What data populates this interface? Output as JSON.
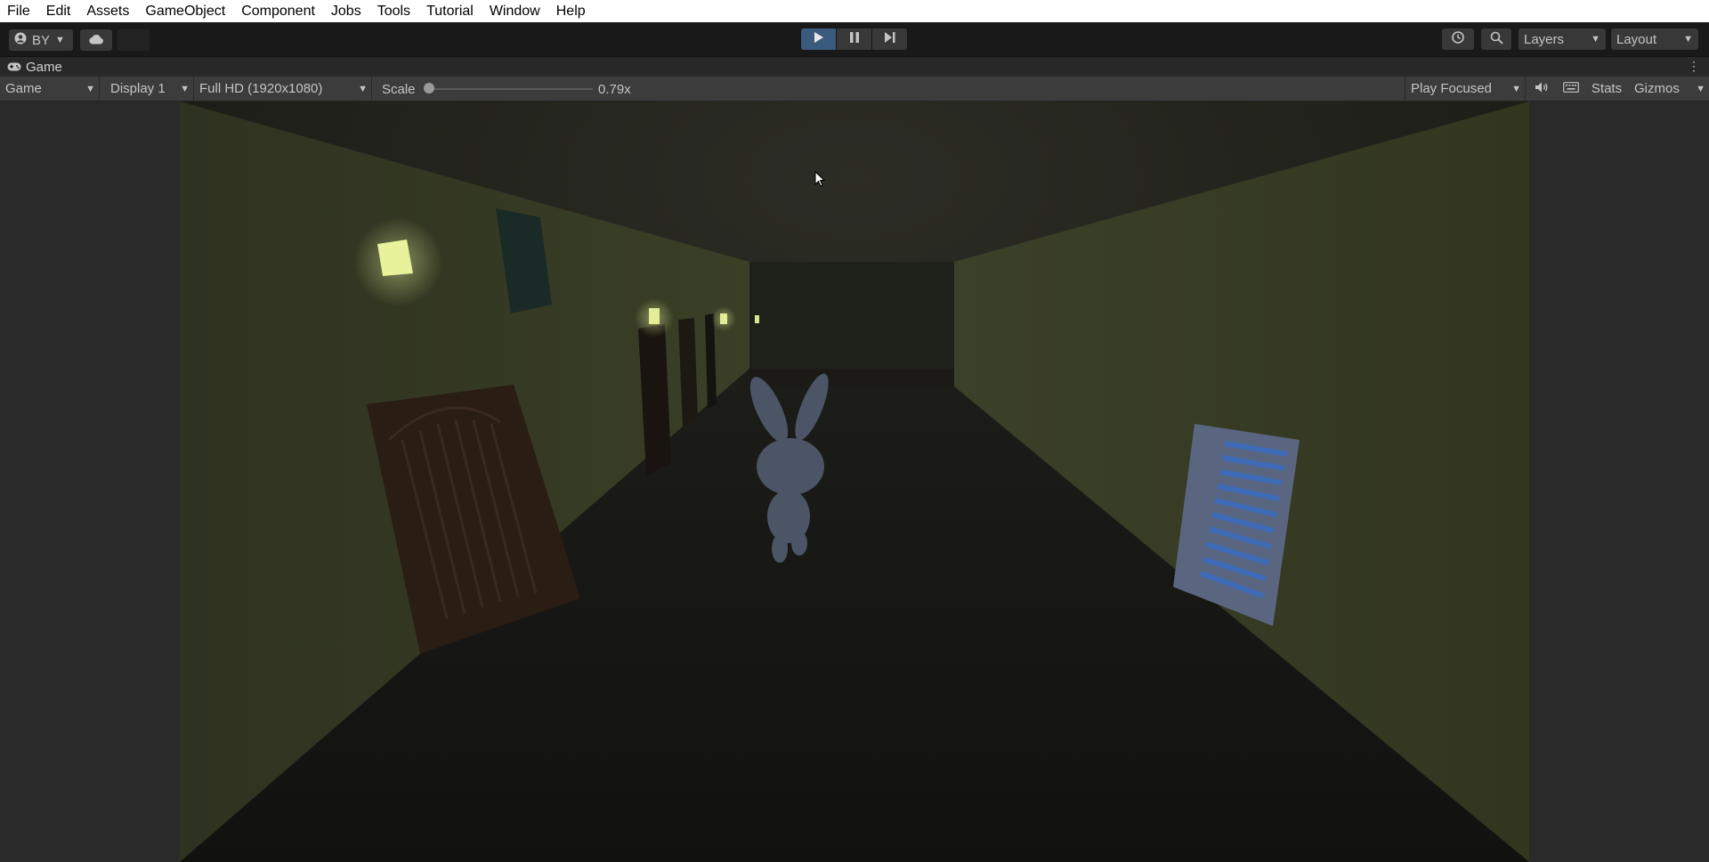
{
  "menu": [
    "File",
    "Edit",
    "Assets",
    "GameObject",
    "Component",
    "Jobs",
    "Tools",
    "Tutorial",
    "Window",
    "Help"
  ],
  "toolbar": {
    "account_label": "BY",
    "layers_label": "Layers",
    "layout_label": "Layout"
  },
  "tab": {
    "label": "Game"
  },
  "game_toolbar": {
    "view_mode": "Game",
    "display": "Display 1",
    "resolution": "Full HD (1920x1080)",
    "scale_label": "Scale",
    "scale_value": "0.79x",
    "play_mode": "Play Focused",
    "stats_label": "Stats",
    "gizmos_label": "Gizmos"
  },
  "icons": {
    "play": "play-icon",
    "pause": "pause-icon",
    "step": "step-icon",
    "cloud": "cloud-icon",
    "account": "account-icon",
    "history": "history-icon",
    "search": "search-icon",
    "mute": "speaker-icon",
    "keyboard": "keyboard-icon"
  },
  "colors": {
    "play_active": "#3a5a7e",
    "panel": "#3c3c3c",
    "background": "#191919"
  }
}
